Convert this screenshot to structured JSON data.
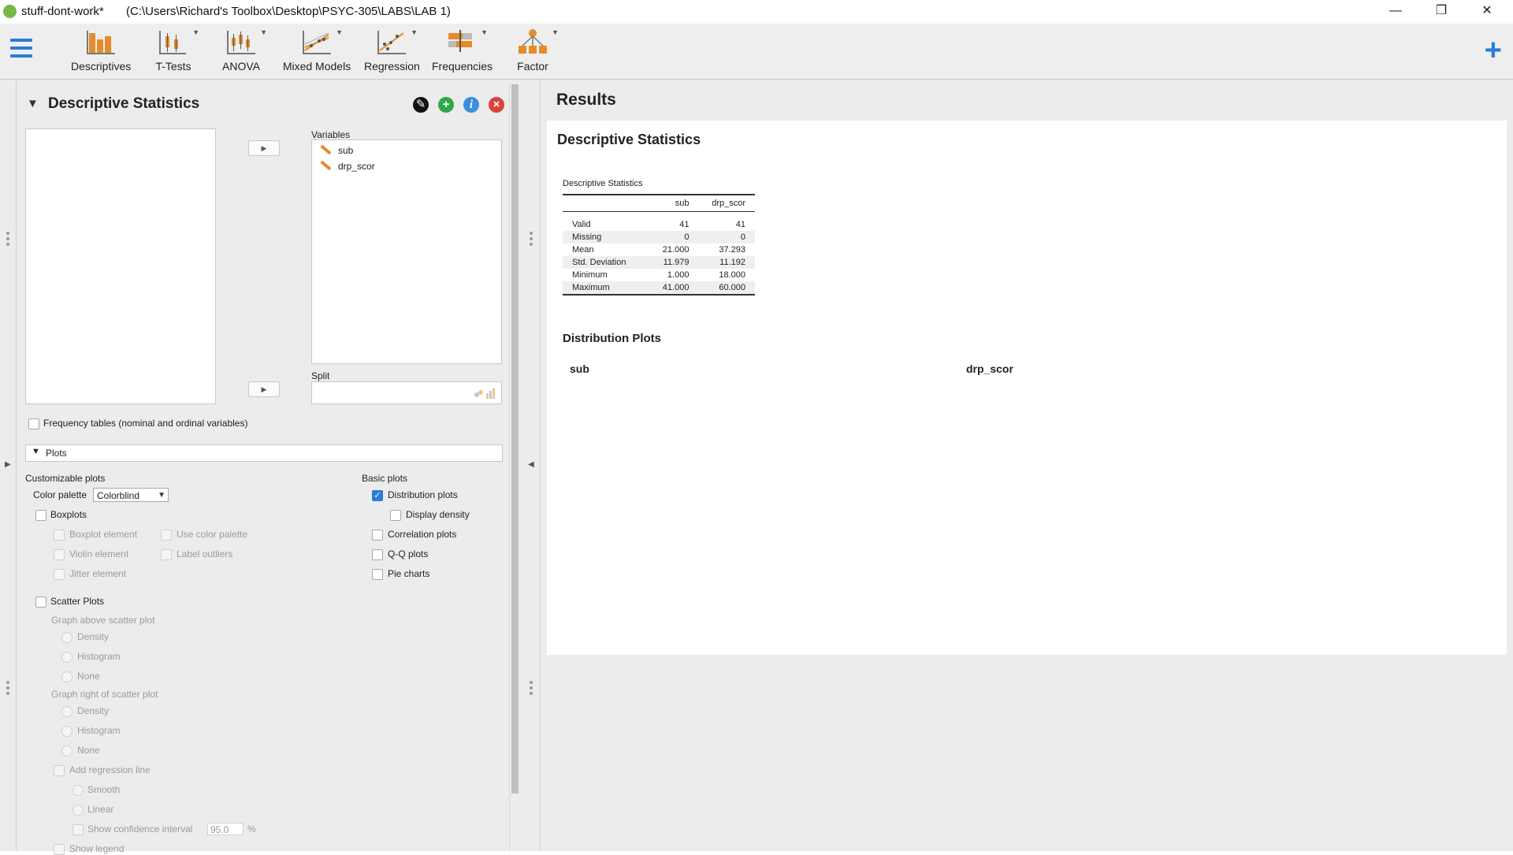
{
  "window": {
    "doc_name": "stuff-dont-work*",
    "path": "(C:\\Users\\Richard's Toolbox\\Desktop\\PSYC-305\\LABS\\LAB 1)",
    "controls": {
      "minimize": "—",
      "restore": "❐",
      "close": "✕"
    }
  },
  "ribbon": {
    "items": [
      {
        "label": "Descriptives",
        "icon": "descriptives-icon"
      },
      {
        "label": "T-Tests",
        "icon": "t-tests-icon"
      },
      {
        "label": "ANOVA",
        "icon": "anova-icon"
      },
      {
        "label": "Mixed Models",
        "icon": "mixed-models-icon"
      },
      {
        "label": "Regression",
        "icon": "regression-icon"
      },
      {
        "label": "Frequencies",
        "icon": "frequencies-icon"
      },
      {
        "label": "Factor",
        "icon": "factor-icon"
      }
    ],
    "plus": "+",
    "accent": "#2a7cd6"
  },
  "analysis": {
    "title": "Descriptive Statistics",
    "variables_label": "Variables",
    "variables": [
      "sub",
      "drp_scor"
    ],
    "split_label": "Split",
    "frequency_tables": "Frequency tables (nominal and ordinal variables)",
    "plots_section": "Plots",
    "customizable_plots": "Customizable plots",
    "color_palette_label": "Color palette",
    "color_palette_value": "Colorblind",
    "boxplots": "Boxplots",
    "boxplot_element": "Boxplot element",
    "use_color_palette": "Use color palette",
    "violin_element": "Violin element",
    "label_outliers": "Label outliers",
    "jitter_element": "Jitter element",
    "scatter_plots": "Scatter Plots",
    "graph_above": "Graph above scatter plot",
    "graph_right": "Graph right of scatter plot",
    "density": "Density",
    "histogram": "Histogram",
    "none": "None",
    "add_regression_line": "Add regression line",
    "smooth": "Smooth",
    "linear": "Linear",
    "show_ci": "Show confidence interval",
    "ci_value": "95.0",
    "ci_unit": "%",
    "show_legend": "Show legend",
    "basic_plots": "Basic plots",
    "distribution_plots": "Distribution plots",
    "display_density": "Display density",
    "correlation_plots": "Correlation plots",
    "qq_plots": "Q-Q plots",
    "pie_charts": "Pie charts"
  },
  "results": {
    "title": "Results",
    "heading": "Descriptive Statistics",
    "table_title": "Descriptive Statistics",
    "columns": [
      "",
      "sub",
      "drp_scor"
    ],
    "rows": [
      [
        "Valid",
        "41",
        "41"
      ],
      [
        "Missing",
        "0",
        "0"
      ],
      [
        "Mean",
        "21.000",
        "37.293"
      ],
      [
        "Std. Deviation",
        "11.979",
        "11.192"
      ],
      [
        "Minimum",
        "1.000",
        "18.000"
      ],
      [
        "Maximum",
        "41.000",
        "60.000"
      ]
    ],
    "dist_heading": "Distribution Plots",
    "dist_vars": [
      "sub",
      "drp_scor"
    ]
  }
}
